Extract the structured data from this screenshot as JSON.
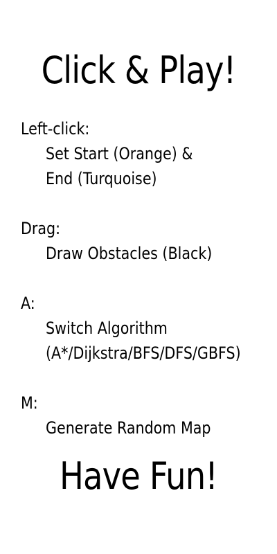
{
  "title": "Click & Play!",
  "instructions": [
    {
      "key": "Left-click:",
      "lines": [
        "Set Start (Orange) &",
        "End (Turquoise)"
      ]
    },
    {
      "key": "Drag:",
      "lines": [
        "Draw Obstacles (Black)"
      ]
    },
    {
      "key": "A:",
      "lines": [
        "Switch Algorithm",
        "(A*/Dijkstra/BFS/DFS/GBFS)"
      ]
    },
    {
      "key": "M:",
      "lines": [
        "Generate Random Map"
      ]
    }
  ],
  "footer": "Have Fun!",
  "colors": {
    "background": "#ffffff",
    "text": "#000000"
  }
}
